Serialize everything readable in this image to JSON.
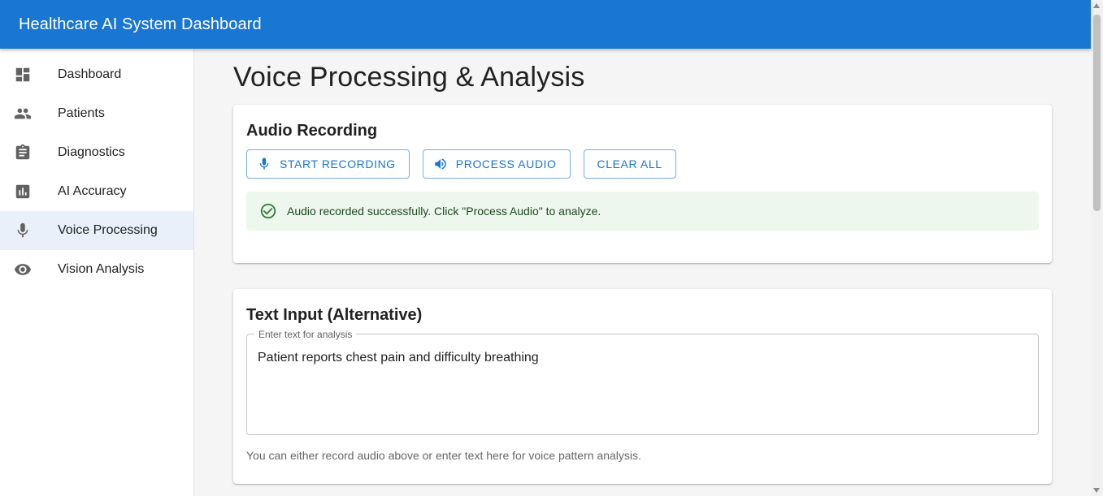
{
  "appbar": {
    "title": "Healthcare AI System Dashboard",
    "color": "#1976d2"
  },
  "sidebar": {
    "items": [
      {
        "label": "Dashboard",
        "icon": "dashboard-icon",
        "selected": false
      },
      {
        "label": "Patients",
        "icon": "people-icon",
        "selected": false
      },
      {
        "label": "Diagnostics",
        "icon": "clipboard-icon",
        "selected": false
      },
      {
        "label": "AI Accuracy",
        "icon": "bar-chart-icon",
        "selected": false
      },
      {
        "label": "Voice Processing",
        "icon": "microphone-icon",
        "selected": true
      },
      {
        "label": "Vision Analysis",
        "icon": "eye-icon",
        "selected": false
      }
    ]
  },
  "main": {
    "title": "Voice Processing & Analysis",
    "audio_card": {
      "title": "Audio Recording",
      "buttons": {
        "start": "START RECORDING",
        "process": "PROCESS AUDIO",
        "clear": "CLEAR ALL"
      },
      "alert": "Audio recorded successfully. Click \"Process Audio\" to analyze."
    },
    "text_card": {
      "title": "Text Input (Alternative)",
      "field_label": "Enter text for analysis",
      "field_value": "Patient reports chest pain and difficulty breathing",
      "helper": "You can either record audio above or enter text here for voice pattern analysis."
    }
  }
}
